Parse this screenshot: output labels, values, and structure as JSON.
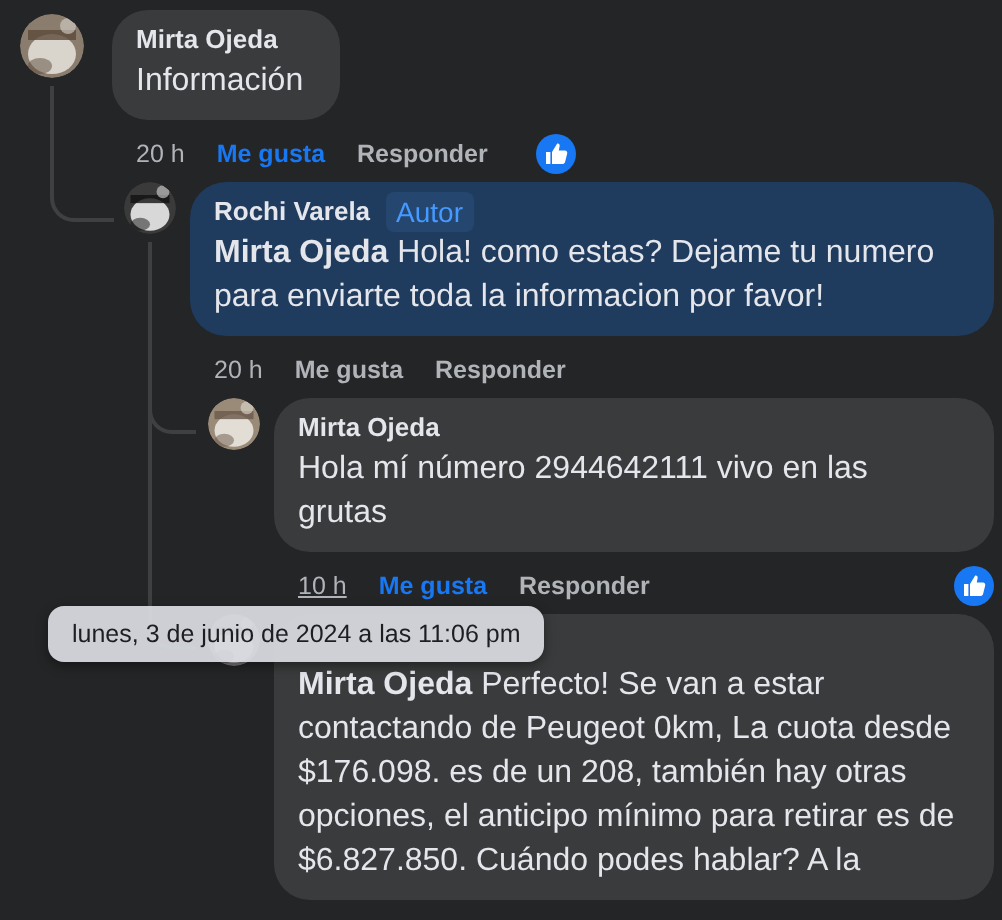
{
  "comments": [
    {
      "author": "Mirta Ojeda",
      "text": "Información",
      "time": "20 h",
      "time_hovered": false,
      "like_label": "Me gusta",
      "reply_label": "Responder",
      "liked": true,
      "reacted": true,
      "highlighted": false,
      "children": [
        {
          "author": "Rochi Varela",
          "badge": "Autor",
          "text": "**Mirta Ojeda** Hola! como estas? Dejame tu numero para enviarte toda la informacion por favor!",
          "time": "20 h",
          "time_hovered": false,
          "like_label": "Me gusta",
          "reply_label": "Responder",
          "liked": false,
          "reacted": false,
          "highlighted": true,
          "children": [
            {
              "author": "Mirta Ojeda",
              "text": "Hola mí número 2944642111 vivo en las grutas",
              "time": "10 h",
              "time_hovered": true,
              "like_label": "Me gusta",
              "reply_label": "Responder",
              "liked": true,
              "reacted": true,
              "highlighted": false
            },
            {
              "text": "**Mirta Ojeda** Perfecto! Se van a estar contactando de Peugeot 0km, La cuota desde $176.098. es de un 208, también hay otras opciones, el anticipo mínimo para retirar es de $6.827.850. Cuándo podes hablar? A la",
              "highlighted": false
            }
          ]
        }
      ]
    }
  ],
  "tooltip": "lunes, 3 de junio de 2024 a las 11:06 pm"
}
